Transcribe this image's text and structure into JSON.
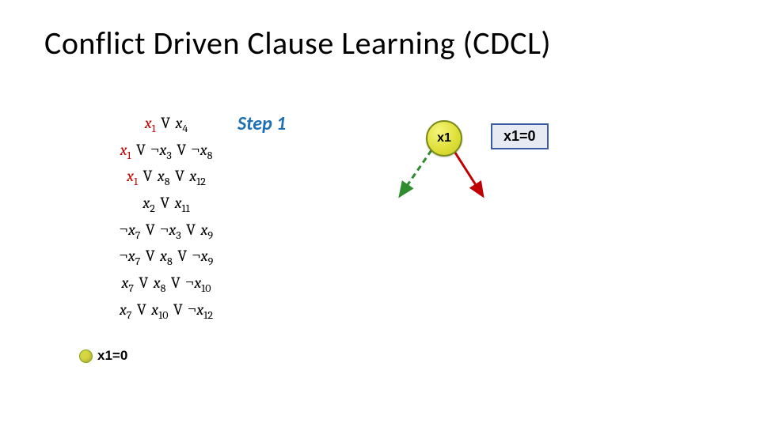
{
  "title": "Conflict Driven Clause Learning (CDCL)",
  "step_label": "Step 1",
  "clauses": [
    {
      "highlight_x1": true,
      "items": [
        {
          "neg": false,
          "v": "x",
          "s": "1"
        },
        {
          "neg": false,
          "v": "x",
          "s": "4"
        }
      ]
    },
    {
      "highlight_x1": true,
      "items": [
        {
          "neg": false,
          "v": "x",
          "s": "1"
        },
        {
          "neg": true,
          "v": "x",
          "s": "3"
        },
        {
          "neg": true,
          "v": "x",
          "s": "8"
        }
      ]
    },
    {
      "highlight_x1": true,
      "items": [
        {
          "neg": false,
          "v": "x",
          "s": "1"
        },
        {
          "neg": false,
          "v": "x",
          "s": "8"
        },
        {
          "neg": false,
          "v": "x",
          "s": "12"
        }
      ]
    },
    {
      "highlight_x1": false,
      "items": [
        {
          "neg": false,
          "v": "x",
          "s": "2"
        },
        {
          "neg": false,
          "v": "x",
          "s": "11"
        }
      ]
    },
    {
      "highlight_x1": false,
      "items": [
        {
          "neg": true,
          "v": "x",
          "s": "7"
        },
        {
          "neg": true,
          "v": "x",
          "s": "3"
        },
        {
          "neg": false,
          "v": "x",
          "s": "9"
        }
      ]
    },
    {
      "highlight_x1": false,
      "items": [
        {
          "neg": true,
          "v": "x",
          "s": "7"
        },
        {
          "neg": false,
          "v": "x",
          "s": "8"
        },
        {
          "neg": true,
          "v": "x",
          "s": "9"
        }
      ]
    },
    {
      "highlight_x1": false,
      "items": [
        {
          "neg": false,
          "v": "x",
          "s": "7"
        },
        {
          "neg": false,
          "v": "x",
          "s": "8"
        },
        {
          "neg": true,
          "v": "x",
          "s": "10"
        }
      ]
    },
    {
      "highlight_x1": false,
      "items": [
        {
          "neg": false,
          "v": "x",
          "s": "7"
        },
        {
          "neg": false,
          "v": "x",
          "s": "10"
        },
        {
          "neg": true,
          "v": "x",
          "s": "12"
        }
      ]
    }
  ],
  "node_label": "x1",
  "box_label": "x1=0",
  "legend_label": "x1=0",
  "disjunction_glyph": "V",
  "negation_glyph": "¬"
}
